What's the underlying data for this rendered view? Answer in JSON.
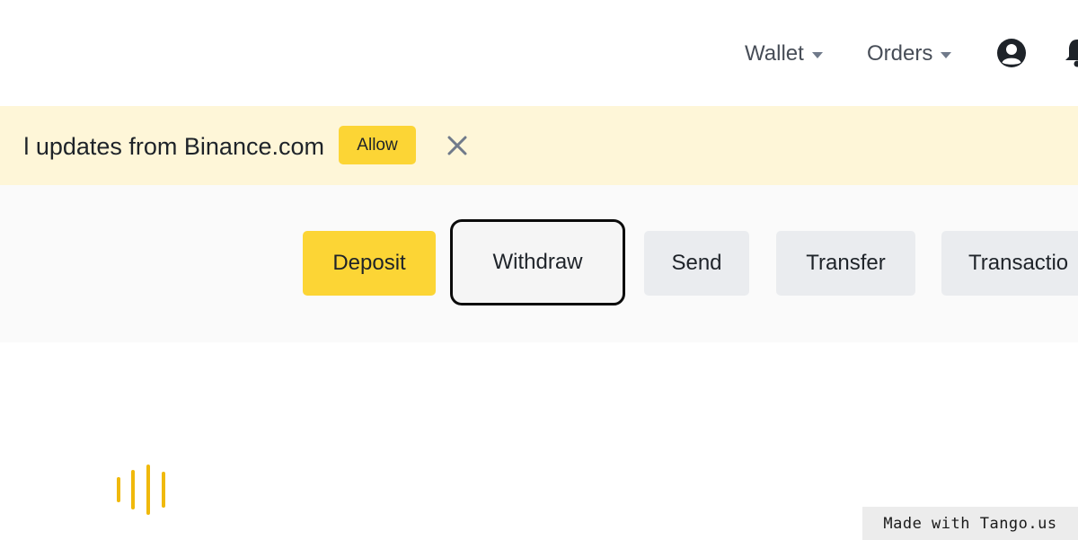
{
  "nav": {
    "wallet_label": "Wallet",
    "orders_label": "Orders",
    "account_icon": "account-circle-icon",
    "bell_icon": "bell-icon"
  },
  "banner": {
    "text": "l updates from Binance.com",
    "allow_label": "Allow",
    "close_icon": "close-icon",
    "background": "#fef6d8"
  },
  "actions": {
    "deposit_label": "Deposit",
    "withdraw_label": "Withdraw",
    "send_label": "Send",
    "transfer_label": "Transfer",
    "transaction_label": "Transactio"
  },
  "loader": {
    "icon": "loading-bars-icon",
    "color": "#f0b90b"
  },
  "watermark": {
    "text": "Made with Tango.us"
  },
  "colors": {
    "brand_yellow": "#fcd535",
    "secondary_button": "#eaecef"
  }
}
